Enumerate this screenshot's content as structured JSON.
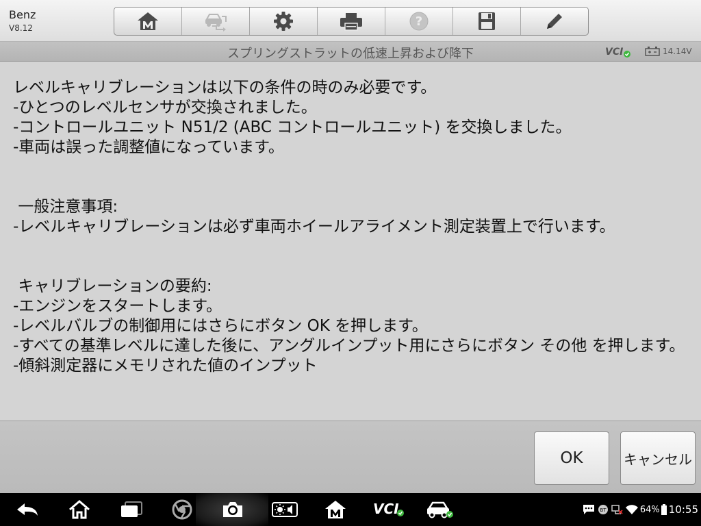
{
  "app": {
    "name": "Benz",
    "version": "V8.12"
  },
  "toolbar": {
    "buttons": [
      {
        "icon": "home-icon",
        "enabled": true
      },
      {
        "icon": "vehicle-swap-icon",
        "enabled": false
      },
      {
        "icon": "gear-icon",
        "enabled": true
      },
      {
        "icon": "printer-icon",
        "enabled": true
      },
      {
        "icon": "help-icon",
        "enabled": false
      },
      {
        "icon": "save-icon",
        "enabled": true
      },
      {
        "icon": "pencil-icon",
        "enabled": true
      }
    ]
  },
  "titlebar": {
    "title": "スプリングストラットの低速上昇および降下",
    "vci": "VCI",
    "voltage": "14.14V"
  },
  "message": {
    "lines": [
      "レベルキャリブレーションは以下の条件の時のみ必要です。",
      "-ひとつのレベルセンサが交換されました。",
      "-コントロールユニット N51/2 (ABC コントロールユニット) を交換しました。",
      "-車両は誤った調整値になっています。",
      "",
      "",
      " 一般注意事項:",
      "-レベルキャリブレーションは必ず車両ホイールアライメント測定装置上で行います。",
      "",
      "",
      " キャリブレーションの要約:",
      "-エンジンをスタートします。",
      "-レベルバルブの制御用にはさらにボタン OK を押します。",
      "-すべての基準レベルに達した後に、アングルインプット用にさらにボタン その他 を押します。",
      "-傾斜測定器にメモリされた値のインプット"
    ]
  },
  "actions": {
    "ok_label": "OK",
    "cancel_label": "キャンセル"
  },
  "navbar": {
    "vci_label": "VCI",
    "battery_percent": "64%",
    "time": "10:55"
  },
  "colors": {
    "vci_ok": "#3fb83f",
    "background": "#d4d4d4"
  }
}
